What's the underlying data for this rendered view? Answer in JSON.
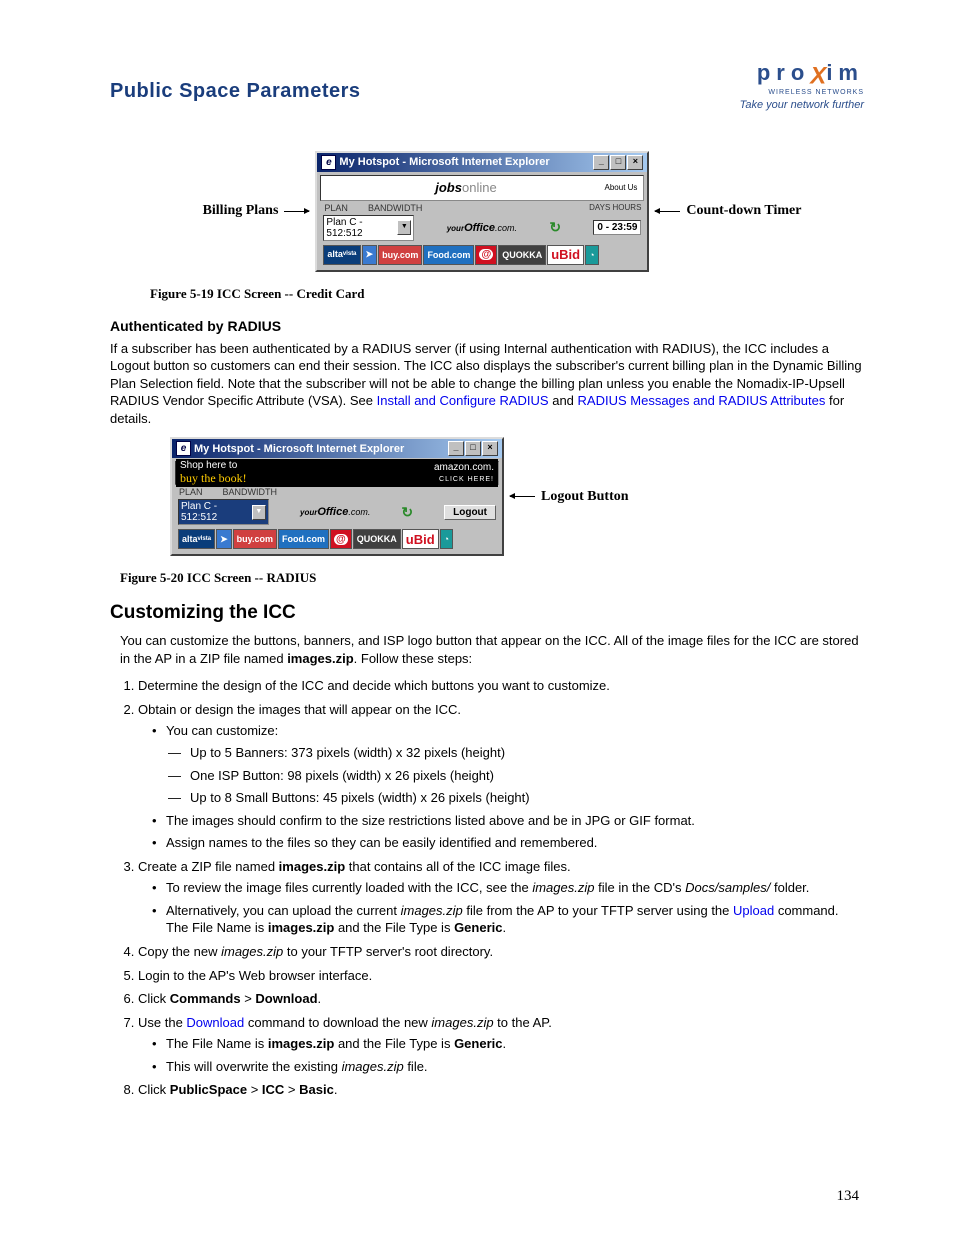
{
  "header": {
    "pageTitle": "Public Space Parameters"
  },
  "logo": {
    "brand_pre": "pro",
    "brand_x": "X",
    "brand_post": "im",
    "sub": "WIRELESS NETWORKS",
    "tag": "Take your network further"
  },
  "fig19": {
    "annot_left": "Billing Plans",
    "annot_right": "Count-down Timer",
    "win_title": "My Hotspot - Microsoft Internet Explorer",
    "banner_main": "jobs",
    "banner_main2": "online",
    "banner_right": "About Us",
    "lbl_plan": "PLAN",
    "lbl_bw": "BANDWIDTH",
    "lbl_days": "DAYS  HOURS",
    "dd_value": "Plan C - 512:512",
    "office_pre": "your",
    "office_main": "Office",
    "office_suf": ".com.",
    "timer": "0 - 23:59",
    "btns": {
      "alta": "altaᵛⁱˢᵗᵃ",
      "buy": "buy.com",
      "food": "Food.com",
      "quokka": "QUOKKA",
      "ubid": "uBid"
    },
    "caption": "Figure 5-19    ICC Screen -- Credit Card"
  },
  "section_auth": {
    "heading": "Authenticated by RADIUS",
    "p_before_link1": "If a subscriber has been authenticated by a RADIUS server (if using Internal authentication with RADIUS), the ICC includes a Logout button so customers can end their session. The ICC also displays the subscriber's current billing plan in the Dynamic Billing Plan Selection field. Note that the subscriber will not be able to change the billing plan unless you enable the Nomadix-IP-Upsell RADIUS Vendor Specific Attribute (VSA). See ",
    "link1": "Install and Configure RADIUS",
    "p_mid": " and ",
    "link2": "RADIUS Messages and RADIUS Attributes",
    "p_after": " for details."
  },
  "fig20": {
    "annot_right": "Logout Button",
    "win_title": "My Hotspot - Microsoft Internet Explorer",
    "banner_shop": "Shop here to",
    "banner_buy": "buy the book!",
    "banner_amazon": "amazon.com.",
    "banner_click": "CLICK HERE!",
    "lbl_plan": "PLAN",
    "lbl_bw": "BANDWIDTH",
    "dd_value": "Plan C - 512:512",
    "office_pre": "your",
    "office_main": "Office",
    "office_suf": ".com.",
    "logout": "Logout",
    "caption": "Figure 5-20    ICC Screen -- RADIUS"
  },
  "customize": {
    "heading": "Customizing the ICC",
    "intro_a": "You can customize the buttons, banners, and ISP logo button that appear on the ICC. All of the image files for the ICC are stored in the AP in a ZIP file named ",
    "intro_zip": "images.zip",
    "intro_b": ". Follow these steps:",
    "s1": "Determine the design of the ICC and decide which buttons you want to customize.",
    "s2": "Obtain or design the images that will appear on the ICC.",
    "s2a": "You can customize:",
    "s2a1": "Up to 5 Banners: 373 pixels (width) x 32 pixels (height)",
    "s2a2": "One ISP Button: 98 pixels (width) x 26 pixels (height)",
    "s2a3": "Up to 8 Small Buttons: 45 pixels (width) x 26 pixels (height)",
    "s2b": "The images should confirm to the size restrictions listed above and be in JPG or GIF format.",
    "s2c": "Assign names to the files so they can be easily identified and remembered.",
    "s3_a": "Create a ZIP file named ",
    "s3_b": "images.zip",
    "s3_c": " that contains all of the ICC image files.",
    "s3i_a": "To review the image files currently loaded with the ICC, see the ",
    "s3i_it": "images.zip",
    "s3i_b": " file in the CD's ",
    "s3i_it2": "Docs/samples/",
    "s3i_c": " folder.",
    "s3ii_a": "Alternatively, you can upload the current ",
    "s3ii_it": "images.zip",
    "s3ii_b": " file from the AP to your TFTP server using the ",
    "s3ii_link": "Upload",
    "s3ii_c": " command. The File Name is ",
    "s3ii_b2": "images.zip",
    "s3ii_d": " and the File Type is ",
    "s3ii_b3": "Generic",
    "s3ii_e": ".",
    "s4_a": "Copy the new ",
    "s4_it": "images.zip",
    "s4_b": " to your TFTP server's root directory.",
    "s5": "Login to the AP's Web browser interface.",
    "s6_a": "Click ",
    "s6_b1": "Commands",
    "s6_gt": " > ",
    "s6_b2": "Download",
    "s6_c": ".",
    "s7_a": "Use the ",
    "s7_link": "Download",
    "s7_b": " command to download the new ",
    "s7_it": "images.zip",
    "s7_c": " to the AP.",
    "s7i_a": "The File Name is ",
    "s7i_b1": "images.zip",
    "s7i_b": " and the File Type is ",
    "s7i_b2": "Generic",
    "s7i_c": ".",
    "s7ii_a": "This will overwrite the existing ",
    "s7ii_it": "images.zip",
    "s7ii_b": " file.",
    "s8_a": "Click ",
    "s8_b1": "PublicSpace",
    "s8_gt": " > ",
    "s8_b2": "ICC",
    "s8_gt2": " > ",
    "s8_b3": "Basic",
    "s8_c": "."
  },
  "pageNum": "134"
}
